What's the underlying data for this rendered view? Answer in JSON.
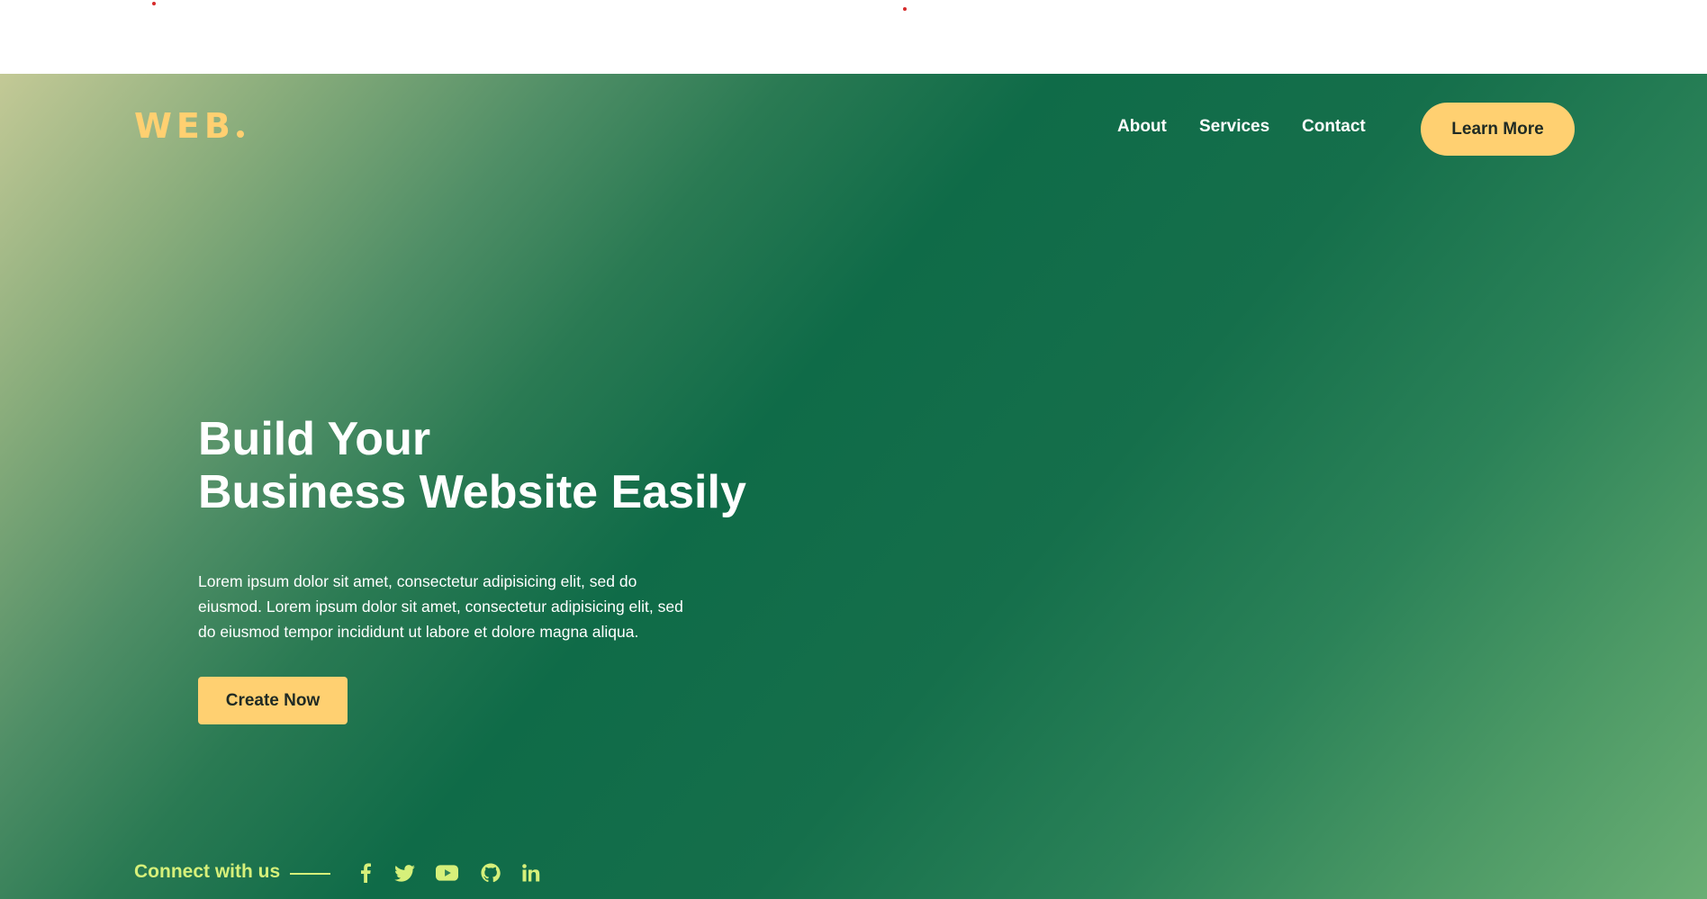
{
  "brand": {
    "name": "WEB"
  },
  "nav": {
    "about": "About",
    "services": "Services",
    "contact": "Contact",
    "cta": "Learn More"
  },
  "hero": {
    "title_line1": "Build Your",
    "title_line2": "Business Website Easily",
    "description": "Lorem ipsum dolor sit amet, consectetur adipisicing elit, sed do eiusmod. Lorem ipsum dolor sit amet, consectetur adipisicing elit, sed do eiusmod tempor incididunt ut labore et dolore magna aliqua.",
    "cta": "Create Now"
  },
  "social": {
    "label": "Connect with us",
    "icons": [
      "facebook-icon",
      "twitter-icon",
      "youtube-icon",
      "github-icon",
      "linkedin-icon"
    ]
  },
  "colors": {
    "accent": "#ffd071",
    "connect": "#d6f07a",
    "hero_dark": "#0f6b48",
    "hero_light": "#c3c996"
  }
}
